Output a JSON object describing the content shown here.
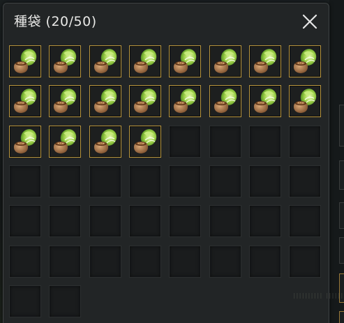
{
  "window": {
    "title": "種袋 (20/50)",
    "close_icon": "close-icon"
  },
  "inventory": {
    "used": 20,
    "capacity": 50,
    "visible_slots": 50,
    "columns": 8,
    "item_icon": "cabbage-seed-bag-icon",
    "filled_border_color": "#b9963e",
    "empty_border_color": "#2c2f30"
  },
  "background": {
    "partial_text": "IIIIIIIIII IIIIII"
  }
}
